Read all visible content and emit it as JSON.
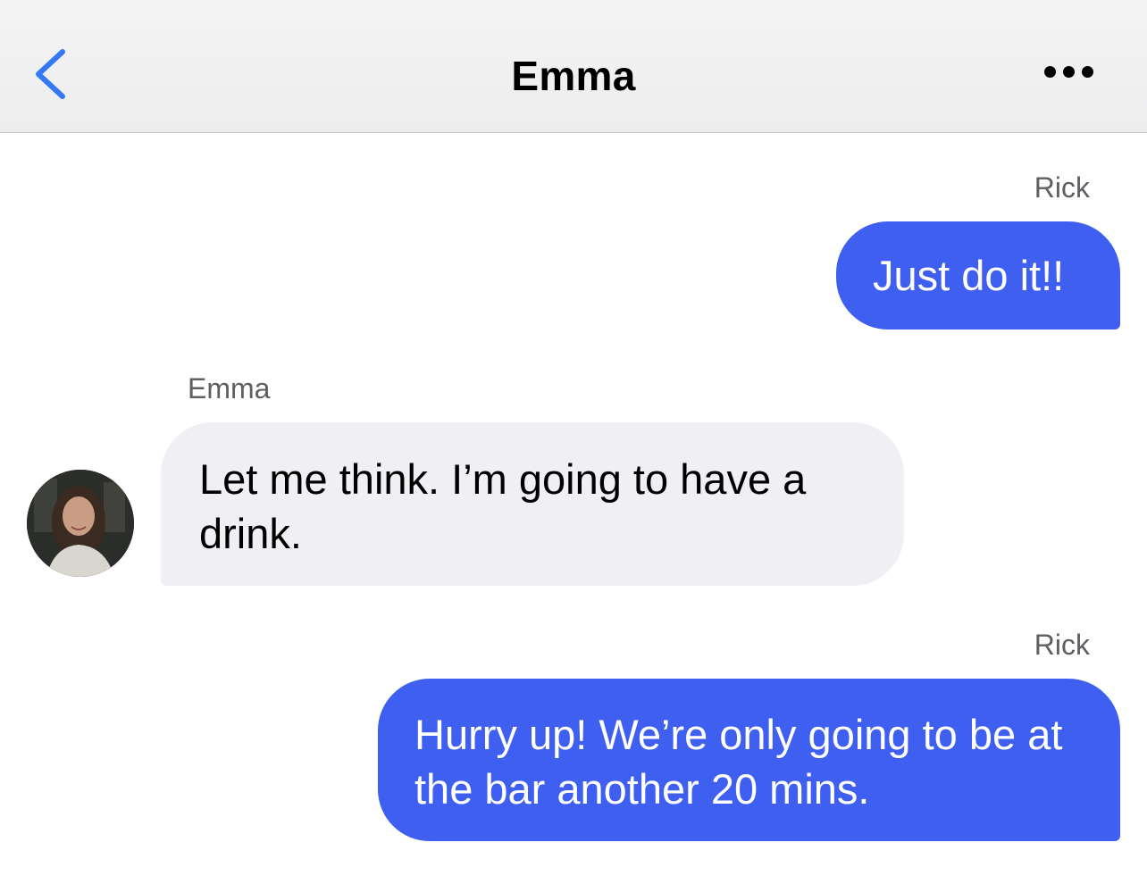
{
  "header": {
    "title": "Emma",
    "back_icon": "chevron-left-icon",
    "more_icon": "ellipsis-icon"
  },
  "messages": [
    {
      "sender": "Rick",
      "text": "Just do it!!",
      "direction": "outgoing"
    },
    {
      "sender": "Emma",
      "text": "Let me think. I’m going to have a drink.",
      "direction": "incoming"
    },
    {
      "sender": "Rick",
      "text": "Hurry up! We’re only going to be at the bar another 20 mins.",
      "direction": "outgoing"
    }
  ],
  "colors": {
    "accent": "#3478f6",
    "outgoing_bubble": "#3f5ff0",
    "incoming_bubble": "#f0f0f4",
    "sender_label": "#5f5f63"
  }
}
